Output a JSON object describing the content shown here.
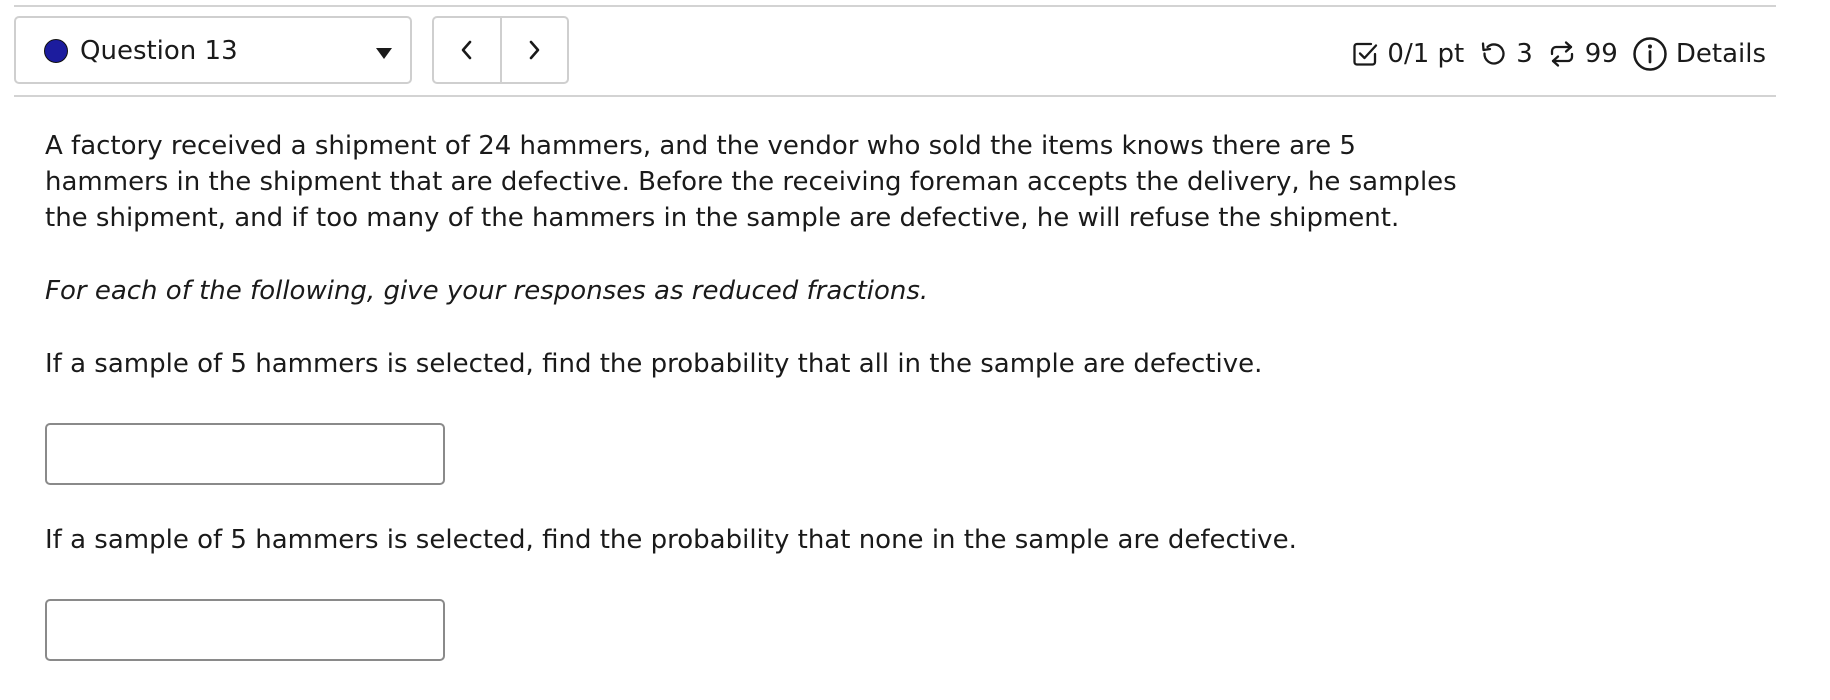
{
  "question_selector": {
    "label": "Question 13",
    "status_color": "#1c1c9e"
  },
  "navigation": {
    "prev_icon": "chevron-left-icon",
    "next_icon": "chevron-right-icon"
  },
  "status_bar": {
    "points": "0/1 pt",
    "retries": "3",
    "attempts": "99",
    "details_label": "Details"
  },
  "question": {
    "intro": "A factory received a shipment of 24 hammers, and the vendor who sold the items knows there are 5 hammers in the shipment that are defective. Before the receiving foreman accepts the delivery, he samples the shipment, and if too many of the hammers in the sample are defective, he will refuse the shipment.",
    "instruction": "For each of the following, give your responses as reduced fractions.",
    "parts": [
      {
        "prompt": "If a sample of 5 hammers is selected, find the probability that all in the sample are defective.",
        "answer_value": ""
      },
      {
        "prompt": "If a sample of 5 hammers is selected, find the probability that none in the sample are defective.",
        "answer_value": ""
      }
    ]
  }
}
